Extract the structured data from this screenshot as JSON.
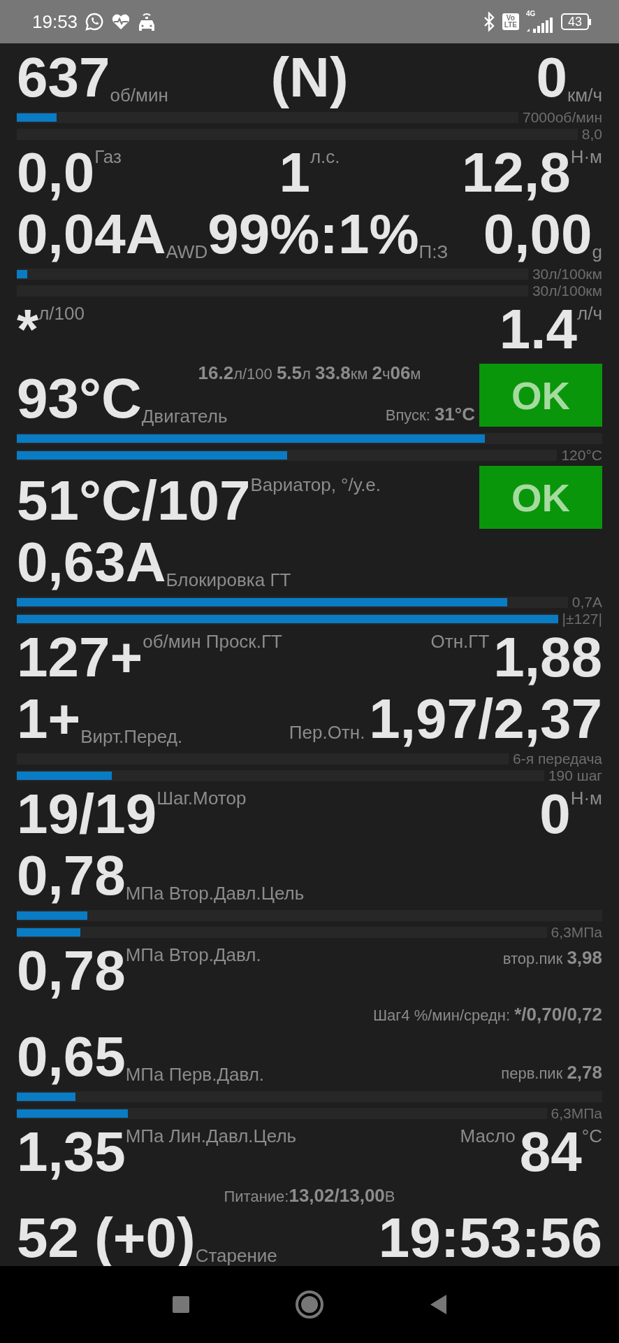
{
  "status_bar": {
    "time": "19:53",
    "volte": [
      "Vo",
      "LTE"
    ],
    "network": "4G",
    "battery": "43"
  },
  "rows": [
    {
      "kind": "readout",
      "left": [
        {
          "kind": "value",
          "value": "637",
          "unit": "об/мин"
        }
      ],
      "center": [
        {
          "kind": "value",
          "value": "(N)"
        }
      ],
      "right": [
        {
          "kind": "value",
          "value": "0",
          "unit": "км/ч"
        }
      ]
    },
    {
      "kind": "bars",
      "bars": [
        {
          "level": 0.08,
          "caption": "7000об/мин"
        },
        {
          "caption": "8,0"
        }
      ]
    },
    {
      "kind": "readout",
      "left": [
        {
          "kind": "raised",
          "value": "0,0",
          "unit": "Газ"
        }
      ],
      "center": [
        {
          "kind": "raised",
          "value": "1",
          "unit": "л.с."
        }
      ],
      "right": [
        {
          "kind": "raised",
          "value": "12,8",
          "unit": "Н·м"
        }
      ]
    },
    {
      "kind": "readout",
      "left": [
        {
          "kind": "value",
          "value": "0,04A",
          "unit": "AWD"
        }
      ],
      "center": [
        {
          "kind": "value",
          "value": "99%:1%",
          "unit": "П:З"
        }
      ],
      "right": [
        {
          "kind": "value",
          "value": "0,00",
          "unit": "g"
        }
      ]
    },
    {
      "kind": "bars",
      "bars": [
        {
          "level": 0.02,
          "caption": "30л/100км"
        },
        {
          "caption": "30л/100км"
        }
      ]
    },
    {
      "kind": "readout",
      "left": [
        {
          "kind": "raised",
          "value": "*",
          "unit": "л/100"
        }
      ],
      "right": [
        {
          "kind": "raised",
          "value": "1.4",
          "unit": "л/ч"
        }
      ]
    },
    {
      "kind": "info",
      "text": "**16.2**л/100 **5.5**л **33.8**км **2**ч**06**м"
    },
    {
      "kind": "readout",
      "left": [
        {
          "kind": "value",
          "value": "93°C",
          "unit": "Двигатель"
        }
      ],
      "right": [
        {
          "kind": "remark",
          "label": "Впуск:",
          "value": "31°C"
        },
        {
          "kind": "badge",
          "text": "OK"
        }
      ]
    },
    {
      "kind": "bars",
      "bars": [
        {
          "level": 0.8
        },
        {
          "level": 0.5,
          "caption": "120°C"
        }
      ]
    },
    {
      "kind": "readout",
      "left": [
        {
          "kind": "raised",
          "value": "51°C/107",
          "unit": "Вариатор, °/у.е."
        }
      ],
      "right": [
        {
          "kind": "badge",
          "text": "OK"
        }
      ]
    },
    {
      "kind": "readout",
      "left": [
        {
          "kind": "value",
          "value": "0,63A",
          "unit": "Блокировка ГТ"
        }
      ]
    },
    {
      "kind": "bars",
      "bars": [
        {
          "level": 0.89,
          "caption": "0,7A"
        },
        {
          "level": 1,
          "caption": "|±127|"
        }
      ]
    },
    {
      "kind": "readout",
      "left": [
        {
          "kind": "raised",
          "value": "127+",
          "unit": "об/мин Проск.ГТ"
        }
      ],
      "right": [
        {
          "kind": "label",
          "text": "Отн.ГТ"
        },
        {
          "kind": "value",
          "value": "1,88"
        }
      ]
    },
    {
      "kind": "readout",
      "left": [
        {
          "kind": "value",
          "value": "1+",
          "unit": "Вирт.Перед."
        }
      ],
      "right": [
        {
          "kind": "caption",
          "text": "Пер.Отн."
        },
        {
          "kind": "value",
          "value": "1,97/2,37"
        }
      ]
    },
    {
      "kind": "bars",
      "bars": [
        {
          "caption": "6-я передача"
        },
        {
          "level": 0.18,
          "caption": "190 шаг"
        }
      ]
    },
    {
      "kind": "readout",
      "left": [
        {
          "kind": "raised",
          "value": "19/19",
          "unit": "Шаг.Мотор"
        }
      ],
      "right": [
        {
          "kind": "raised",
          "value": "0",
          "unit": "Н·м"
        }
      ]
    },
    {
      "kind": "readout",
      "left": [
        {
          "kind": "value",
          "value": "0,78",
          "unit": "МПа Втор.Давл.Цель"
        }
      ]
    },
    {
      "kind": "bars",
      "bars": [
        {
          "level": 0.12
        },
        {
          "level": 0.12,
          "caption": "6,3МПа"
        }
      ]
    },
    {
      "kind": "readout",
      "left": [
        {
          "kind": "raised",
          "value": "0,78",
          "unit": "МПа Втор.Давл."
        }
      ],
      "right": [
        {
          "kind": "note",
          "label": "втор.пик",
          "value": "3,98"
        }
      ]
    },
    {
      "kind": "stat",
      "label": "Шаг4 %/мин/средн:",
      "value": "*/0,70/0,72"
    },
    {
      "kind": "readout",
      "left": [
        {
          "kind": "value",
          "value": "0,65",
          "unit": "МПа Перв.Давл."
        }
      ],
      "right": [
        {
          "kind": "remark",
          "label": "перв.пик",
          "value": "2,78"
        }
      ]
    },
    {
      "kind": "bars",
      "bars": [
        {
          "level": 0.1
        },
        {
          "level": 0.21,
          "caption": "6,3МПа"
        }
      ]
    },
    {
      "kind": "readout",
      "left": [
        {
          "kind": "raised",
          "value": "1,35",
          "unit": "МПа Лин.Давл.Цель"
        }
      ],
      "right": [
        {
          "kind": "label",
          "text": "Масло"
        },
        {
          "kind": "raised",
          "value": "84",
          "unit": "°C"
        }
      ]
    },
    {
      "kind": "info",
      "text": "Питание:**13,02/13,00**В"
    },
    {
      "kind": "readout",
      "left": [
        {
          "kind": "value",
          "value": "52 (+0)",
          "unit": "Старение"
        }
      ],
      "right": [
        {
          "kind": "value",
          "value": "19:53:56"
        }
      ]
    }
  ]
}
